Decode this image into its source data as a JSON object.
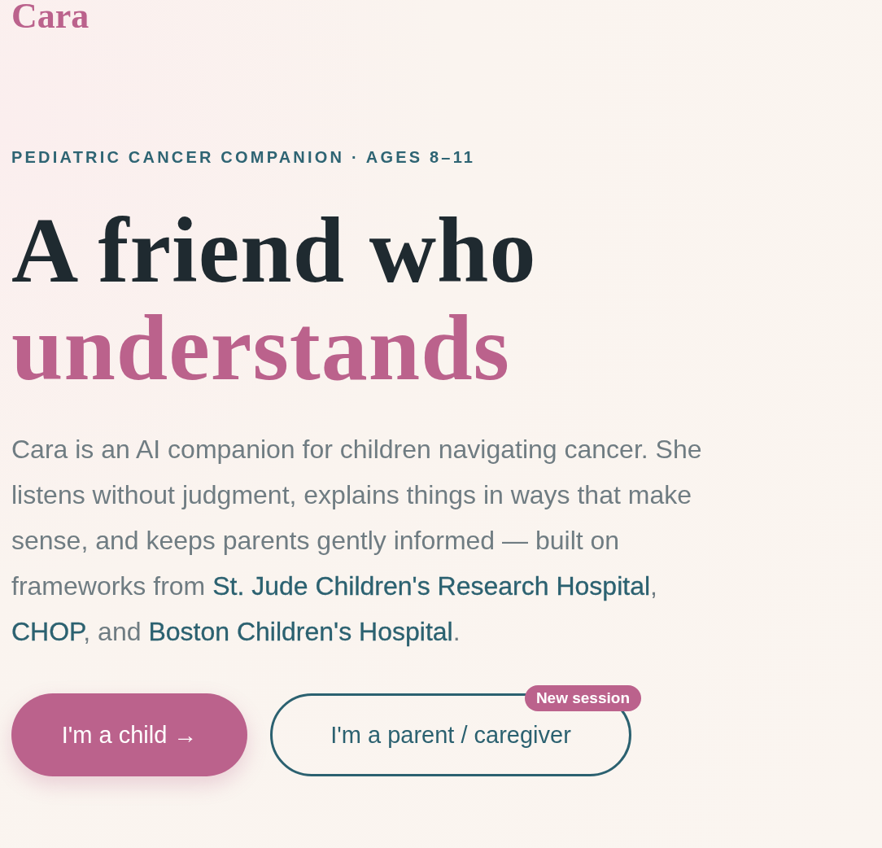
{
  "logo": "Cara",
  "eyebrow": "PEDIATRIC CANCER COMPANION · AGES 8–11",
  "headline": {
    "line1": "A friend who",
    "line2": "understands"
  },
  "intro": "Cara is an AI companion for children navigating cancer. She listens without judgment, explains things in ways that make sense, and keeps parents gently informed — built on frameworks from **St. Jude Children's Research Hospital**, **CHOP**, and **Boston Children's Hospital**.",
  "buttons": [
    {
      "label": "I'm a child →",
      "kind": "primary"
    },
    {
      "label": "I'm a parent / caregiver",
      "kind": "outline",
      "badge": "New session"
    }
  ]
}
